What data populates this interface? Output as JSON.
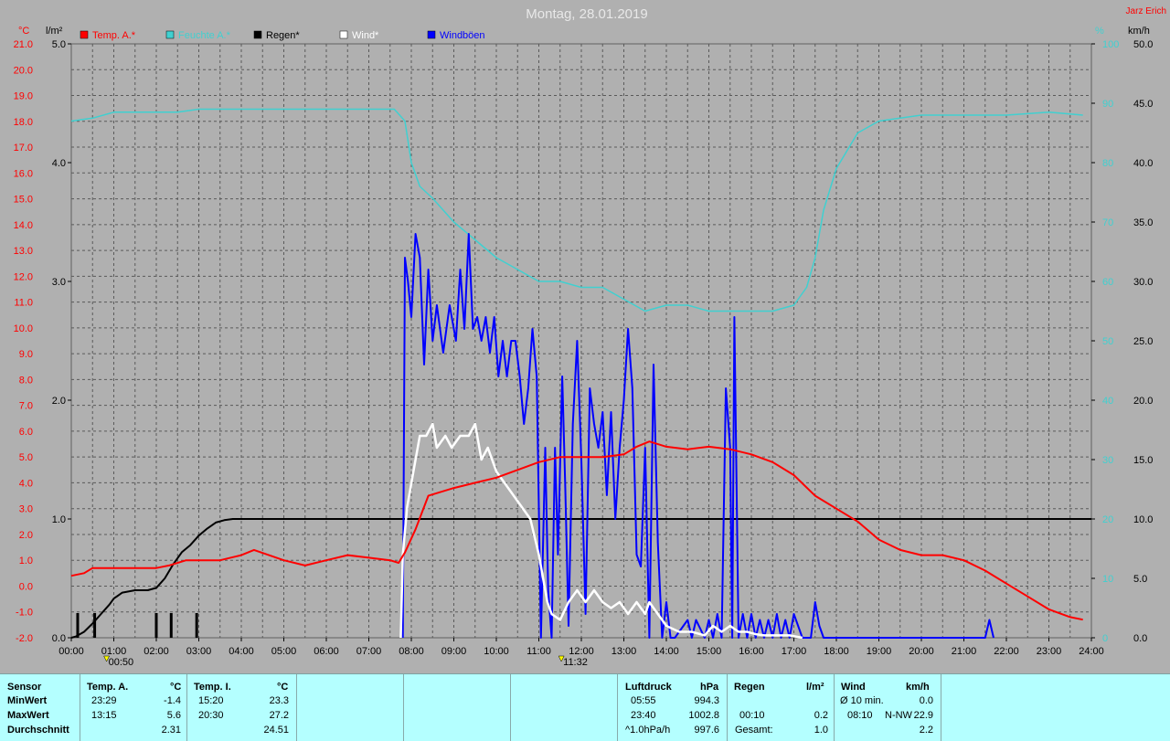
{
  "title": "Montag, 28.01.2019",
  "author": "Jarz Erich",
  "colors": {
    "bg": "#b0b0b0",
    "temp": "#ff0000",
    "hum": "#40d0d0",
    "rain": "#000000",
    "wind": "#ffffff",
    "gust": "#0000ff",
    "stats_bg": "#b4ffff"
  },
  "legend": [
    {
      "label": "Temp. A.*",
      "color": "#ff0000"
    },
    {
      "label": "Feuchte A.*",
      "color": "#40d0d0"
    },
    {
      "label": "Regen*",
      "color": "#000000"
    },
    {
      "label": "Wind*",
      "color": "#ffffff"
    },
    {
      "label": "Windböen",
      "color": "#0000ff"
    }
  ],
  "axis_units": {
    "left_temp": "°C",
    "left_rain": "l/m²",
    "right_hum": "%",
    "right_wind": "km/h"
  },
  "x_ticks": [
    "00:00",
    "01:00",
    "02:00",
    "03:00",
    "04:00",
    "05:00",
    "06:00",
    "07:00",
    "08:00",
    "09:00",
    "10:00",
    "11:00",
    "12:00",
    "13:00",
    "14:00",
    "15:00",
    "16:00",
    "17:00",
    "18:00",
    "19:00",
    "20:00",
    "21:00",
    "22:00",
    "23:00",
    "24:00"
  ],
  "temp_ticks": [
    "-2.0",
    "-1.0",
    "0.0",
    "1.0",
    "2.0",
    "3.0",
    "4.0",
    "5.0",
    "6.0",
    "7.0",
    "8.0",
    "9.0",
    "10.0",
    "11.0",
    "12.0",
    "13.0",
    "14.0",
    "15.0",
    "16.0",
    "17.0",
    "18.0",
    "19.0",
    "20.0",
    "21.0"
  ],
  "rain_ticks": [
    "0.0",
    "1.0",
    "2.0",
    "3.0",
    "4.0",
    "5.0"
  ],
  "hum_ticks": [
    "0",
    "10",
    "20",
    "30",
    "40",
    "50",
    "60",
    "70",
    "80",
    "90",
    "100"
  ],
  "wind_ticks": [
    "0.0",
    "5.0",
    "10.0",
    "15.0",
    "20.0",
    "25.0",
    "30.0",
    "35.0",
    "40.0",
    "45.0",
    "50.0"
  ],
  "markers": [
    {
      "label": "00:50",
      "x": 0.83
    },
    {
      "label": "11:32",
      "x": 11.53
    }
  ],
  "chart_data": {
    "type": "line",
    "title": "Montag, 28.01.2019",
    "xlabel": "",
    "xlim": [
      0,
      24
    ],
    "grid": true,
    "series": [
      {
        "name": "Temp. A.*",
        "unit": "°C",
        "axis": "temp",
        "ylim": [
          -2,
          21
        ],
        "x": [
          0,
          0.3,
          0.5,
          1,
          1.5,
          2,
          2.3,
          2.7,
          3,
          3.5,
          4,
          4.3,
          5,
          5.5,
          6,
          6.5,
          7,
          7.5,
          7.7,
          7.85,
          8.1,
          8.4,
          9,
          9.5,
          10,
          10.5,
          11,
          11.5,
          12,
          12.5,
          13,
          13.3,
          13.6,
          14,
          14.5,
          15,
          15.5,
          16,
          16.5,
          17,
          17.5,
          18,
          18.5,
          19,
          19.5,
          20,
          20.5,
          21,
          21.5,
          22,
          22.5,
          23,
          23.5,
          23.8
        ],
        "values": [
          0.4,
          0.5,
          0.7,
          0.7,
          0.7,
          0.7,
          0.8,
          1.0,
          1.0,
          1.0,
          1.2,
          1.4,
          1.0,
          0.8,
          1.0,
          1.2,
          1.1,
          1.0,
          0.9,
          1.3,
          2.2,
          3.5,
          3.8,
          4.0,
          4.2,
          4.5,
          4.8,
          5.0,
          5.0,
          5.0,
          5.1,
          5.4,
          5.6,
          5.4,
          5.3,
          5.4,
          5.3,
          5.1,
          4.8,
          4.3,
          3.5,
          3.0,
          2.5,
          1.8,
          1.4,
          1.2,
          1.2,
          1.0,
          0.6,
          0.1,
          -0.4,
          -0.9,
          -1.2,
          -1.3
        ]
      },
      {
        "name": "Feuchte A.*",
        "unit": "%",
        "axis": "hum",
        "ylim": [
          0,
          100
        ],
        "x": [
          0,
          0.5,
          1,
          1.5,
          2,
          2.5,
          3,
          4,
          5,
          6,
          7,
          7.6,
          7.85,
          8,
          8.2,
          8.5,
          9,
          9.5,
          10,
          10.5,
          11,
          11.5,
          12,
          12.5,
          13,
          13.5,
          14,
          14.5,
          15,
          15.5,
          16,
          16.5,
          17,
          17.3,
          17.5,
          17.7,
          18,
          18.5,
          19,
          20,
          21,
          22,
          23,
          23.8
        ],
        "values": [
          87,
          87.5,
          88.5,
          88.5,
          88.5,
          88.5,
          89,
          89,
          89,
          89,
          89,
          89,
          87,
          80,
          76,
          74,
          70,
          67,
          64,
          62,
          60,
          60,
          59,
          59,
          57,
          55,
          56,
          56,
          55,
          55,
          55,
          55,
          56,
          59,
          64,
          72,
          79,
          85,
          87,
          88,
          88,
          88,
          88.5,
          88
        ]
      },
      {
        "name": "Regen*",
        "unit": "l/m²",
        "axis": "rain",
        "ylim": [
          0,
          5
        ],
        "x": [
          0,
          0.1,
          0.3,
          0.5,
          0.7,
          0.9,
          1,
          1.2,
          1.5,
          1.8,
          2,
          2.2,
          2.4,
          2.6,
          2.8,
          3,
          3.2,
          3.4,
          3.6,
          3.8,
          4,
          24
        ],
        "values": [
          0,
          0.01,
          0.05,
          0.12,
          0.2,
          0.28,
          0.33,
          0.38,
          0.4,
          0.4,
          0.42,
          0.5,
          0.62,
          0.72,
          0.78,
          0.86,
          0.92,
          0.97,
          0.99,
          1.0,
          1.0,
          1.0
        ]
      },
      {
        "name": "Wind*",
        "unit": "km/h",
        "axis": "wind",
        "ylim": [
          0,
          50
        ],
        "x": [
          7.75,
          7.8,
          7.9,
          8.05,
          8.2,
          8.35,
          8.5,
          8.6,
          8.8,
          8.95,
          9.15,
          9.35,
          9.5,
          9.65,
          9.8,
          10,
          10.2,
          10.4,
          10.6,
          10.8,
          11,
          11.2,
          11.3,
          11.5,
          11.7,
          11.9,
          12.1,
          12.3,
          12.5,
          12.7,
          12.9,
          13.1,
          13.3,
          13.5,
          13.6,
          13.8,
          14,
          14.3,
          14.6,
          14.9,
          15.1,
          15.3,
          15.5,
          15.7,
          15.9,
          16.1,
          16.3,
          16.6,
          16.9,
          17.2
        ],
        "values": [
          0,
          7,
          11,
          14,
          17,
          17,
          18,
          16,
          17,
          16,
          17,
          17,
          18,
          15,
          16,
          14,
          13,
          12,
          11,
          10,
          7,
          3,
          2,
          1.5,
          3,
          4,
          3,
          4,
          3,
          2.5,
          3,
          2,
          3,
          2,
          3,
          2,
          1,
          0.5,
          0.5,
          0.2,
          1,
          0.5,
          1,
          0.5,
          0.5,
          0.3,
          0.2,
          0.2,
          0.2,
          0
        ]
      },
      {
        "name": "Windböen",
        "unit": "km/h",
        "axis": "wind",
        "ylim": [
          0,
          50
        ],
        "x": [
          7.8,
          7.85,
          7.92,
          8,
          8.1,
          8.2,
          8.3,
          8.4,
          8.5,
          8.6,
          8.75,
          8.9,
          9.05,
          9.15,
          9.25,
          9.35,
          9.45,
          9.55,
          9.65,
          9.75,
          9.85,
          9.95,
          10.05,
          10.15,
          10.25,
          10.35,
          10.45,
          10.55,
          10.65,
          10.75,
          10.85,
          10.95,
          11.05,
          11.15,
          11.22,
          11.3,
          11.38,
          11.45,
          11.55,
          11.62,
          11.7,
          11.8,
          11.9,
          12,
          12.1,
          12.2,
          12.3,
          12.4,
          12.5,
          12.6,
          12.7,
          12.8,
          12.9,
          13,
          13.1,
          13.2,
          13.3,
          13.4,
          13.5,
          13.6,
          13.7,
          13.8,
          13.9,
          14,
          14.1,
          14.2,
          14.5,
          14.6,
          14.7,
          14.9,
          15,
          15.1,
          15.2,
          15.3,
          15.4,
          15.5,
          15.55,
          15.6,
          15.7,
          15.8,
          15.9,
          16,
          16.1,
          16.2,
          16.3,
          16.4,
          16.5,
          16.6,
          16.7,
          16.8,
          16.9,
          17,
          17.2,
          17.4,
          17.5,
          17.6,
          17.7,
          21.5,
          21.6,
          21.7
        ],
        "values": [
          0,
          32,
          30,
          27,
          34,
          32,
          23,
          31,
          25,
          28,
          24,
          28,
          25,
          31,
          26,
          34,
          26,
          27,
          25,
          27,
          24,
          27,
          22,
          25,
          22,
          25,
          25,
          22,
          18,
          21,
          26,
          22,
          0,
          16,
          4,
          0,
          16,
          7,
          22,
          13,
          1,
          18,
          25,
          15,
          2,
          21,
          18,
          16,
          19,
          12,
          19,
          10,
          16,
          20,
          26,
          21,
          7,
          6,
          16,
          0,
          23,
          8,
          0,
          3,
          0,
          0,
          1.5,
          0,
          1.5,
          0,
          1.5,
          0,
          2,
          0,
          21,
          16,
          0,
          27,
          0,
          2,
          0,
          2,
          0,
          1.5,
          0,
          1.5,
          0,
          2,
          0,
          1.5,
          0,
          2,
          0,
          0,
          3,
          1,
          0,
          0,
          1.5,
          0
        ]
      }
    ]
  },
  "stats": {
    "sensor": {
      "header": "Sensor",
      "min": "MinWert",
      "max": "MaxWert",
      "avg": "Durchschnitt"
    },
    "temp_a": {
      "header": "Temp. A.",
      "unit": "°C",
      "min_time": "23:29",
      "min_val": "-1.4",
      "max_time": "13:15",
      "max_val": "5.6",
      "avg": "2.31"
    },
    "temp_i": {
      "header": "Temp. I.",
      "unit": "°C",
      "min_time": "15:20",
      "min_val": "23.3",
      "max_time": "20:30",
      "max_val": "27.2",
      "avg": "24.51"
    },
    "pressure": {
      "header": "Luftdruck",
      "unit": "hPa",
      "min_time": "05:55",
      "min_val": "994.3",
      "max_time": "23:40",
      "max_val": "1002.8",
      "avg_label": "^1.0hPa/h",
      "avg": "997.6"
    },
    "rain": {
      "header": "Regen",
      "unit": "l/m²",
      "max_time": "00:10",
      "max_val": "0.2",
      "total_label": "Gesamt:",
      "total": "1.0"
    },
    "wind": {
      "header": "Wind",
      "unit": "km/h",
      "avg_label": "Ø 10 min.",
      "avg": "0.0",
      "max_time": "08:10",
      "max_dir": "N-NW",
      "max_val": "22.9",
      "mean": "2.2"
    }
  }
}
